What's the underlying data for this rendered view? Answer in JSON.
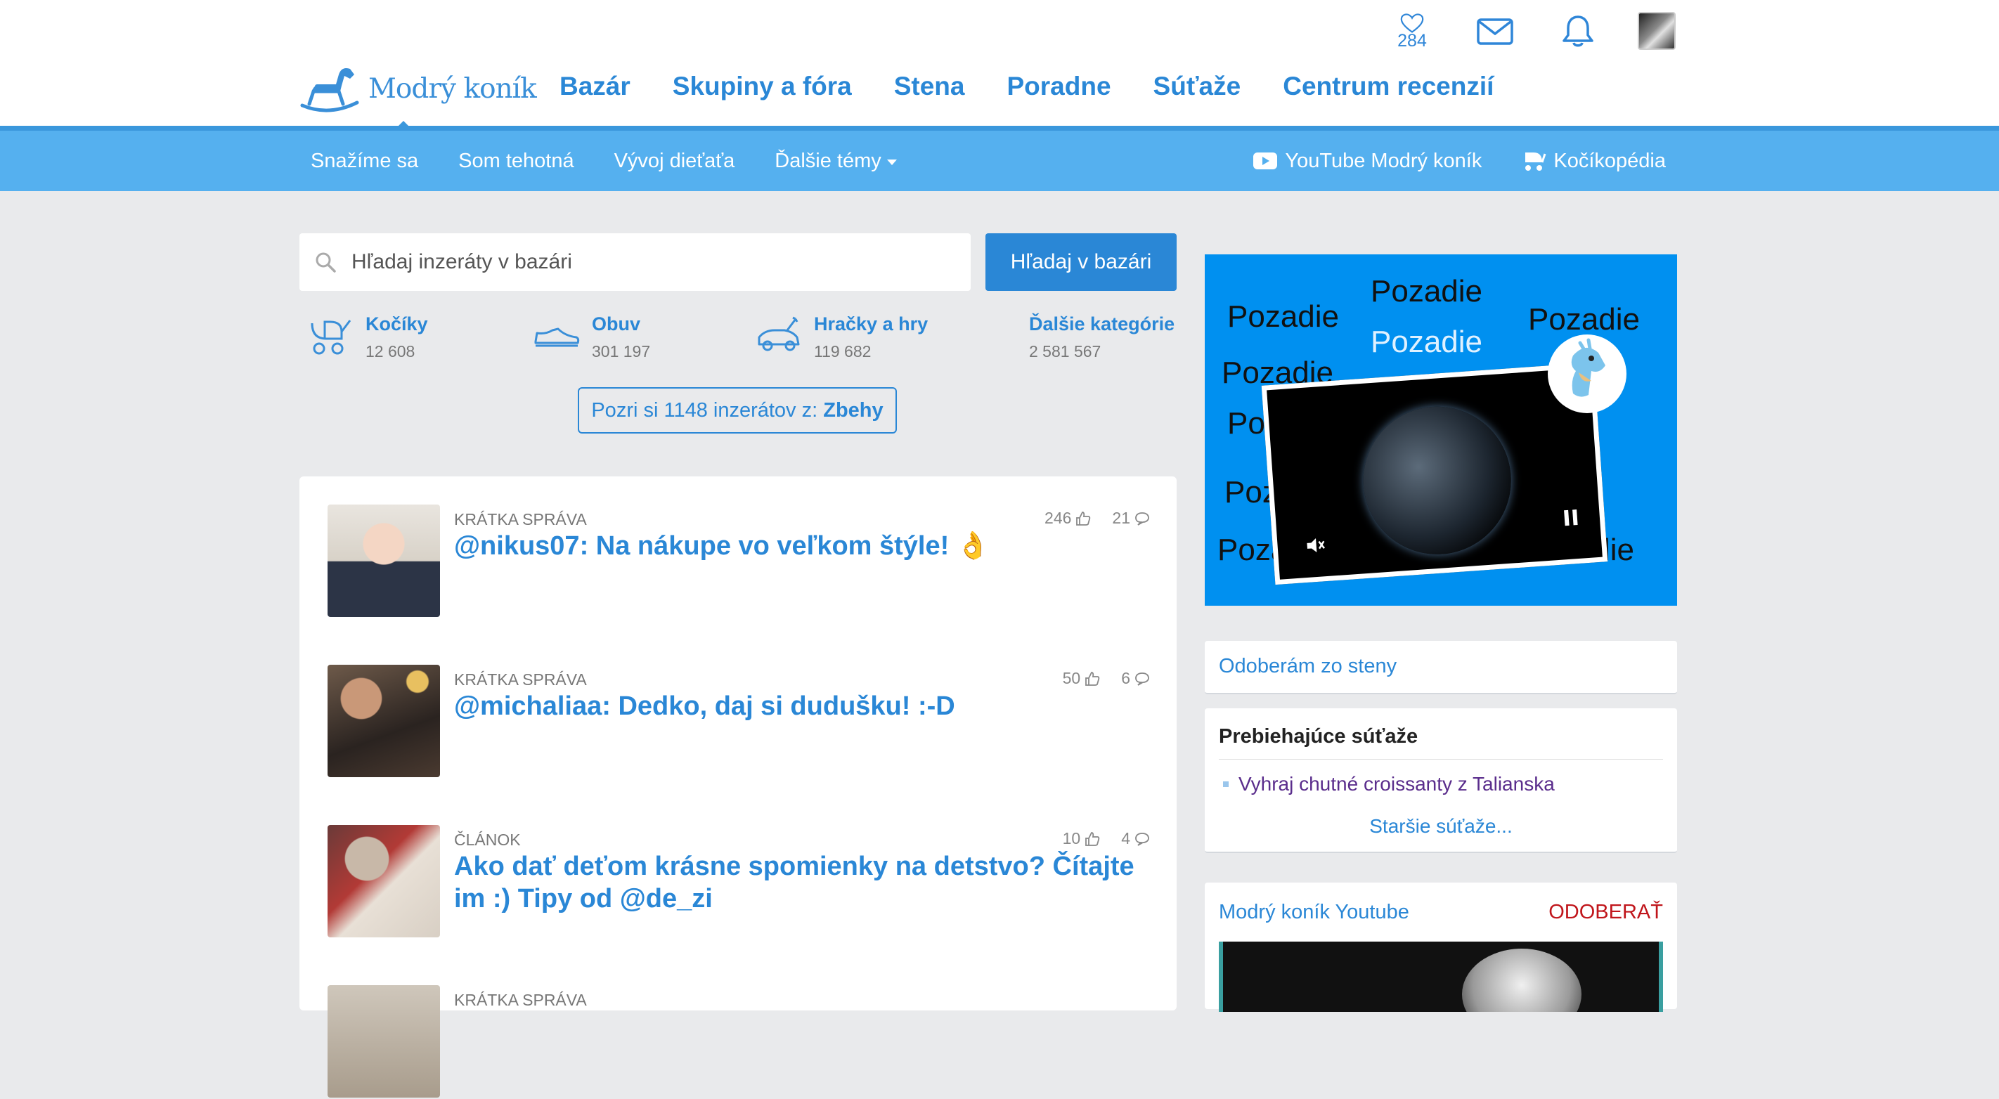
{
  "header": {
    "heart_count": "284",
    "logo_text": "Modrý koník",
    "nav": [
      "Bazár",
      "Skupiny a fóra",
      "Stena",
      "Poradne",
      "Súťaže",
      "Centrum recenzií"
    ]
  },
  "subnav": {
    "left": [
      "Snažíme sa",
      "Som tehotná",
      "Vývoj dieťaťa",
      "Ďalšie témy"
    ],
    "right": [
      "YouTube Modrý koník",
      "Kočíkopédia"
    ]
  },
  "bazaar": {
    "search_placeholder": "Hľadaj inzeráty v bazári",
    "search_button": "Hľadaj v bazári",
    "categories": [
      {
        "name": "Kočíky",
        "count": "12 608"
      },
      {
        "name": "Obuv",
        "count": "301 197"
      },
      {
        "name": "Hračky a hry",
        "count": "119 682"
      },
      {
        "name": "Ďalšie kategórie",
        "count": "2 581 567"
      }
    ],
    "promo_prefix": "Pozri si 1148 inzerátov z: ",
    "promo_category": "Zbehy"
  },
  "feed": [
    {
      "type": "KRÁTKA SPRÁVA",
      "title": "@nikus07: Na nákupe vo veľkom štýle! 👌",
      "likes": "246",
      "comments": "21"
    },
    {
      "type": "KRÁTKA SPRÁVA",
      "title": "@michaliaa: Dedko, daj si dudušku! :-D",
      "likes": "50",
      "comments": "6"
    },
    {
      "type": "ČLÁNOK",
      "title": "Ako dať deťom krásne spomienky na detstvo? Čítajte im :) Tipy od @de_zi",
      "likes": "10",
      "comments": "4"
    },
    {
      "type": "KRÁTKA SPRÁVA",
      "title": "",
      "likes": "",
      "comments": ""
    }
  ],
  "ad": {
    "word": "Pozadie"
  },
  "sidebar": {
    "follow_link": "Odoberám zo steny",
    "contests_title": "Prebiehajúce súťaže",
    "contest_items": [
      "Vyhraj chutné croissanty z Talianska"
    ],
    "contests_more": "Staršie súťaže...",
    "youtube_title": "Modrý koník Youtube",
    "youtube_subscribe": "ODOBERAŤ"
  },
  "colors": {
    "brand_blue": "#2a87d6",
    "subnav_blue": "#55b0ef",
    "subscribe_red": "#c0151b"
  }
}
